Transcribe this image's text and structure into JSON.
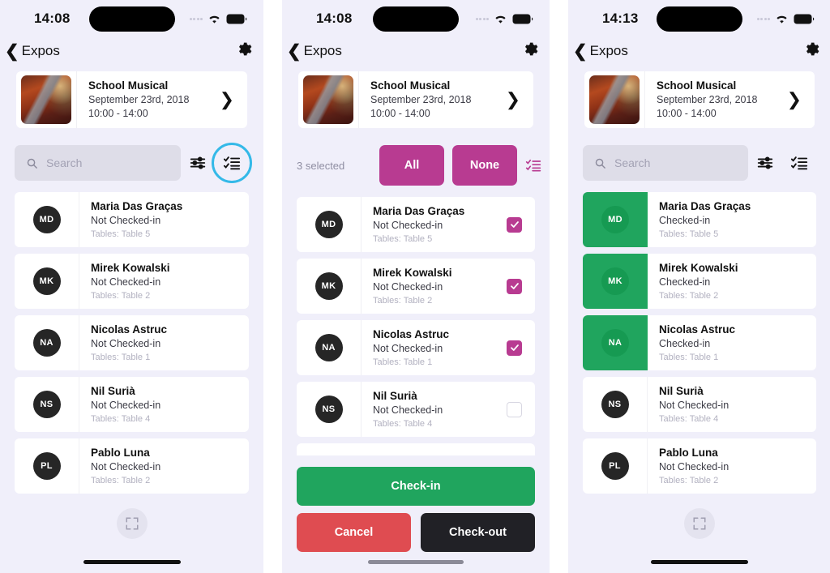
{
  "panels": [
    {
      "id": "browse",
      "status": {
        "time": "14:08",
        "wifi_icon": "wifi-icon",
        "battery_icon": "battery-icon",
        "signal_icon": "signal-dots-icon"
      },
      "nav": {
        "back_label": "Expos",
        "back_icon": "chevron-left-icon",
        "settings_icon": "gear-icon"
      },
      "event": {
        "title": "School Musical",
        "date": "September 23rd, 2018",
        "time": "10:00 - 14:00",
        "thumb_icon": "event-photo",
        "disclosure_icon": "chevron-right-icon"
      },
      "search": {
        "placeholder": "Search",
        "icon": "search-icon"
      },
      "tools": {
        "filter_icon": "sliders-icon",
        "select_icon": "checklist-icon",
        "select_highlighted": true
      },
      "guests": [
        {
          "initials": "MD",
          "name": "Maria Das Graças",
          "status": "Not Checked-in",
          "table": "Tables: Table 5",
          "checked_in": false
        },
        {
          "initials": "MK",
          "name": "Mirek Kowalski",
          "status": "Not Checked-in",
          "table": "Tables: Table 2",
          "checked_in": false
        },
        {
          "initials": "NA",
          "name": "Nicolas Astruc",
          "status": "Not Checked-in",
          "table": "Tables: Table 1",
          "checked_in": false
        },
        {
          "initials": "NS",
          "name": "Nil Surià",
          "status": "Not Checked-in",
          "table": "Tables: Table 4",
          "checked_in": false
        },
        {
          "initials": "PL",
          "name": "Pablo Luna",
          "status": "Not Checked-in",
          "table": "Tables: Table 2",
          "checked_in": false
        }
      ],
      "bottom": {
        "fullscreen_icon": "fullscreen-icon"
      }
    },
    {
      "id": "selection",
      "status": {
        "time": "14:08",
        "wifi_icon": "wifi-icon",
        "battery_icon": "battery-icon",
        "signal_icon": "signal-dots-icon"
      },
      "nav": {
        "back_label": "Expos",
        "back_icon": "chevron-left-icon",
        "settings_icon": "gear-icon"
      },
      "event": {
        "title": "School Musical",
        "date": "September 23rd, 2018",
        "time": "10:00 - 14:00",
        "thumb_icon": "event-photo",
        "disclosure_icon": "chevron-right-icon"
      },
      "selection": {
        "count_label": "3 selected",
        "all_label": "All",
        "none_label": "None",
        "select_icon": "checklist-icon"
      },
      "guests": [
        {
          "initials": "MD",
          "name": "Maria Das Graças",
          "status": "Not Checked-in",
          "table": "Tables: Table 5",
          "selected": true
        },
        {
          "initials": "MK",
          "name": "Mirek Kowalski",
          "status": "Not Checked-in",
          "table": "Tables: Table 2",
          "selected": true
        },
        {
          "initials": "NA",
          "name": "Nicolas Astruc",
          "status": "Not Checked-in",
          "table": "Tables: Table 1",
          "selected": true
        },
        {
          "initials": "NS",
          "name": "Nil Surià",
          "status": "Not Checked-in",
          "table": "Tables: Table 4",
          "selected": false
        }
      ],
      "actions": {
        "checkin_label": "Check-in",
        "cancel_label": "Cancel",
        "checkout_label": "Check-out"
      }
    },
    {
      "id": "checked-in",
      "status": {
        "time": "14:13",
        "wifi_icon": "wifi-icon",
        "battery_icon": "battery-icon",
        "signal_icon": "signal-dots-icon"
      },
      "nav": {
        "back_label": "Expos",
        "back_icon": "chevron-left-icon",
        "settings_icon": "gear-icon"
      },
      "event": {
        "title": "School Musical",
        "date": "September 23rd, 2018",
        "time": "10:00 - 14:00",
        "thumb_icon": "event-photo",
        "disclosure_icon": "chevron-right-icon"
      },
      "search": {
        "placeholder": "Search",
        "icon": "search-icon"
      },
      "tools": {
        "filter_icon": "sliders-icon",
        "select_icon": "checklist-icon",
        "select_highlighted": false
      },
      "guests": [
        {
          "initials": "MD",
          "name": "Maria Das Graças",
          "status": "Checked-in",
          "table": "Tables: Table 5",
          "checked_in": true
        },
        {
          "initials": "MK",
          "name": "Mirek Kowalski",
          "status": "Checked-in",
          "table": "Tables: Table 2",
          "checked_in": true
        },
        {
          "initials": "NA",
          "name": "Nicolas Astruc",
          "status": "Checked-in",
          "table": "Tables: Table 1",
          "checked_in": true
        },
        {
          "initials": "NS",
          "name": "Nil Surià",
          "status": "Not Checked-in",
          "table": "Tables: Table 4",
          "checked_in": false
        },
        {
          "initials": "PL",
          "name": "Pablo Luna",
          "status": "Not Checked-in",
          "table": "Tables: Table 2",
          "checked_in": false
        }
      ],
      "bottom": {
        "fullscreen_icon": "fullscreen-icon"
      }
    }
  ],
  "colors": {
    "magenta": "#b83b91",
    "green": "#20a55e",
    "red": "#df4c51",
    "dark": "#212126",
    "cyan_ring": "#34b9e8",
    "panel_bg": "#f0effa",
    "search_bg": "#dedde8"
  }
}
